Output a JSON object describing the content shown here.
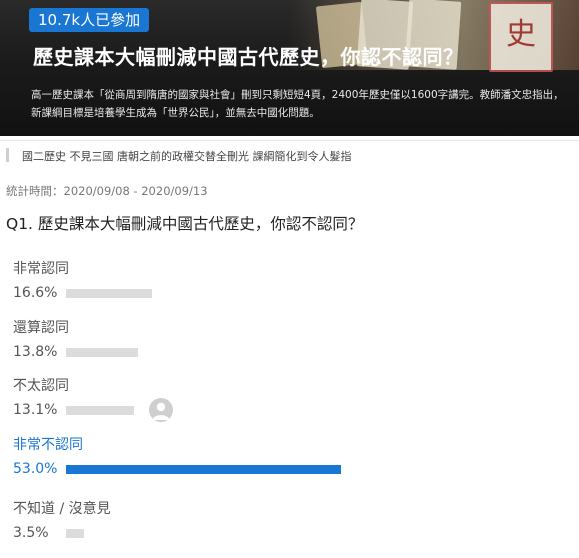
{
  "hero": {
    "badge": "10.7k人已參加",
    "title": "歷史課本大幅刪減中國古代歷史，你認不認同？",
    "description": "高一歷史課本「從商周到隋唐的國家與社會」刪到只剩短短4頁，2400年歷史僅以1600字講完。教師潘文忠指出，新課綱目標是培養學生成為「世界公民」，並無去中國化問題。",
    "collage_glyph": "史"
  },
  "tags": "國二歷史 不見三國 唐朝之前的政權交替全刪光 課綱簡化到令人髮指",
  "stat_period": "統計時間：2020/09/08 - 2020/09/13",
  "question": "Q1. 歷史課本大幅刪減中國古代歷史，你認不認同？",
  "options": [
    {
      "label": "非常認同",
      "percent": "16.6%",
      "value": 16.6,
      "selected": false
    },
    {
      "label": "還算認同",
      "percent": "13.8%",
      "value": 13.8,
      "selected": false
    },
    {
      "label": "不太認同",
      "percent": "13.1%",
      "value": 13.1,
      "selected": false
    },
    {
      "label": "非常不認同",
      "percent": "53.0%",
      "value": 53.0,
      "selected": true
    },
    {
      "label": "不知道 / 沒意見",
      "percent": "3.5%",
      "value": 3.5,
      "selected": false
    }
  ],
  "colors": {
    "accent": "#1976d2",
    "bar_gray": "#dcdcdc"
  }
}
